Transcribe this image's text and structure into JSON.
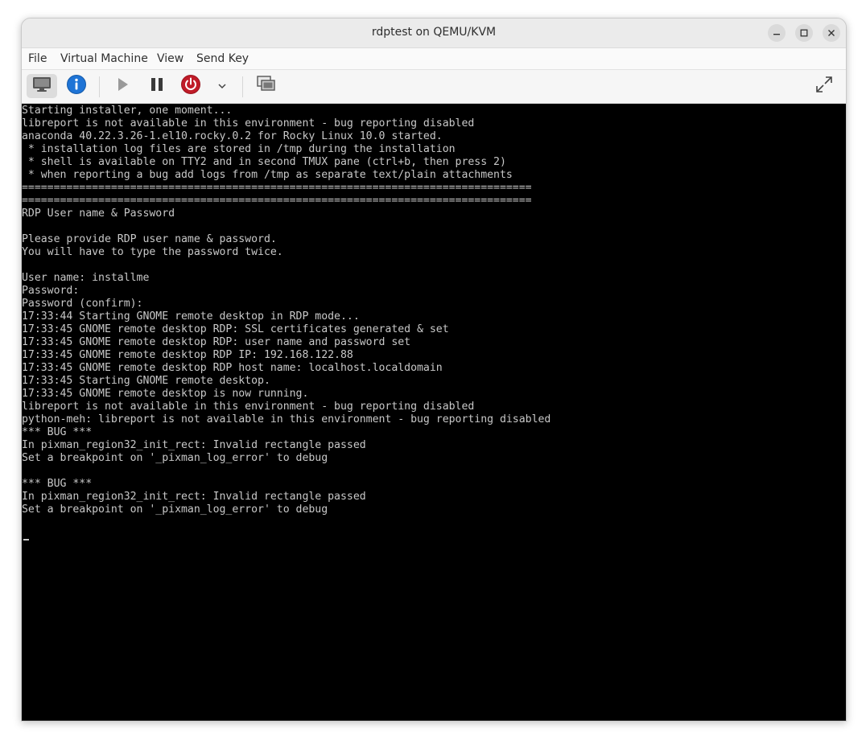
{
  "window": {
    "title": "rdptest on QEMU/KVM"
  },
  "window_controls": {
    "minimize_icon": "minimize-icon",
    "maximize_icon": "maximize-icon",
    "close_icon": "close-icon"
  },
  "menubar": {
    "file": "File",
    "virtual_machine": "Virtual Machine",
    "view": "View",
    "send_key": "Send Key"
  },
  "toolbar": {
    "icons": [
      "console-icon",
      "info-icon",
      "play-icon",
      "pause-icon",
      "power-icon",
      "chevron-down-icon",
      "snapshots-icon",
      "fullscreen-icon"
    ],
    "colors": {
      "info": "#1e74d6",
      "power": "#c01c28"
    }
  },
  "console": {
    "background": "#000000",
    "foreground": "#c8c8c8",
    "lines": [
      "Starting installer, one moment...",
      "libreport is not available in this environment - bug reporting disabled",
      "anaconda 40.22.3.26-1.el10.rocky.0.2 for Rocky Linux 10.0 started.",
      " * installation log files are stored in /tmp during the installation",
      " * shell is available on TTY2 and in second TMUX pane (ctrl+b, then press 2)",
      " * when reporting a bug add logs from /tmp as separate text/plain attachments",
      "================================================================================",
      "================================================================================",
      "RDP User name & Password",
      "",
      "Please provide RDP user name & password.",
      "You will have to type the password twice.",
      "",
      "User name: installme",
      "Password:",
      "Password (confirm):",
      "17:33:44 Starting GNOME remote desktop in RDP mode...",
      "17:33:45 GNOME remote desktop RDP: SSL certificates generated & set",
      "17:33:45 GNOME remote desktop RDP: user name and password set",
      "17:33:45 GNOME remote desktop RDP IP: 192.168.122.88",
      "17:33:45 GNOME remote desktop RDP host name: localhost.localdomain",
      "17:33:45 Starting GNOME remote desktop.",
      "17:33:45 GNOME remote desktop is now running.",
      "libreport is not available in this environment - bug reporting disabled",
      "python-meh: libreport is not available in this environment - bug reporting disabled",
      "*** BUG ***",
      "In pixman_region32_init_rect: Invalid rectangle passed",
      "Set a breakpoint on '_pixman_log_error' to debug",
      "",
      "*** BUG ***",
      "In pixman_region32_init_rect: Invalid rectangle passed",
      "Set a breakpoint on '_pixman_log_error' to debug"
    ]
  }
}
